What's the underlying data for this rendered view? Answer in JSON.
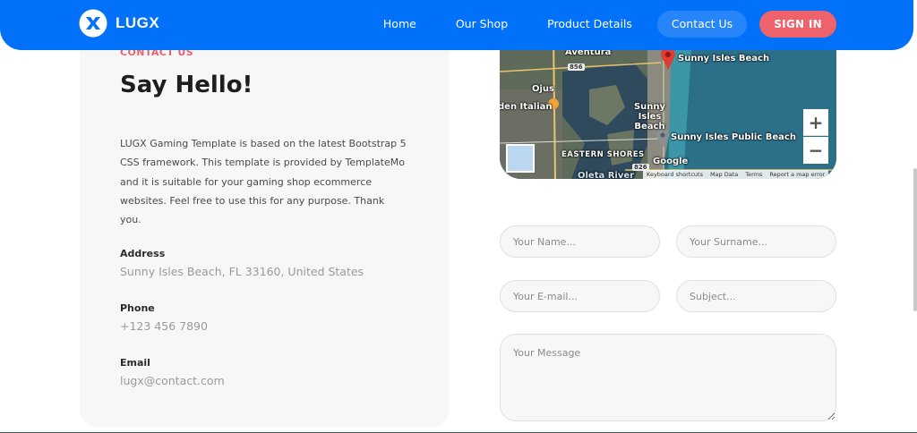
{
  "header": {
    "brand": "LUGX",
    "nav": [
      {
        "label": "Home"
      },
      {
        "label": "Our Shop"
      },
      {
        "label": "Product Details"
      },
      {
        "label": "Contact Us",
        "active": true
      }
    ],
    "signin_label": "SIGN IN",
    "bg_color": "#0071f8",
    "signin_color": "#ee626b"
  },
  "contact": {
    "eyebrow": "CONTACT US",
    "heading": "Say Hello!",
    "description": "LUGX Gaming Template is based on the latest Bootstrap 5 CSS framework. This template is provided by TemplateMo and it is suitable for your gaming shop ecommerce websites. Feel free to use this for any purpose. Thank you.",
    "address_label": "Address",
    "address_value": "Sunny Isles Beach, FL 33160, United States",
    "phone_label": "Phone",
    "phone_value": "+123 456 7890",
    "email_label": "Email",
    "email_value": "lugx@contact.com"
  },
  "map": {
    "places": {
      "aventura": "Aventura",
      "sunny_isles_beach": "Sunny Isles Beach",
      "ojus": "Ojus",
      "italian": "den Italian",
      "sunny_isles": "Sunny Isles Beach",
      "public_beach": "Sunny Isles Public Beach",
      "eastern_shores": "EASTERN SHORES",
      "oleta": "Oleta River",
      "google": "Google"
    },
    "road_856": "856",
    "road_826": "826",
    "zoom_in": "+",
    "zoom_out": "−",
    "attribution": [
      "Keyboard shortcuts",
      "Map Data",
      "Terms",
      "Report a map error"
    ]
  },
  "form": {
    "name_placeholder": "Your Name...",
    "surname_placeholder": "Your Surname...",
    "email_placeholder": "Your E-mail...",
    "subject_placeholder": "Subject...",
    "message_placeholder": "Your Message"
  }
}
